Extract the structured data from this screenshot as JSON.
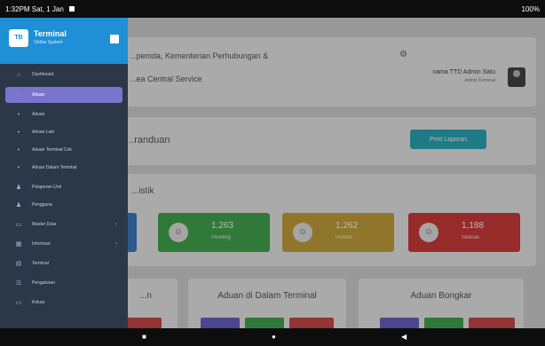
{
  "status_bar": {
    "left_text": "1:32PM Sat, 1 Jan",
    "right_text": "100%"
  },
  "header": {
    "title_line1": "...pemda, Kementerian Perhubungan &",
    "title_line2": "...ea Central Service",
    "user_name": "nama TTD Admin Satu",
    "user_role": "Admin Terminal"
  },
  "page": {
    "title": "...randuan",
    "print_button": "Print Laporan"
  },
  "stats": {
    "title": "...istik",
    "items": [
      {
        "num": "",
        "label": "",
        "color": "#3b7dc4"
      },
      {
        "num": "1,263",
        "label": "Pending",
        "color": "#43a84e"
      },
      {
        "num": "1,262",
        "label": "Proses",
        "color": "#c8a43b"
      },
      {
        "num": "1,188",
        "label": "Selesai",
        "color": "#d13c39"
      }
    ]
  },
  "lower_cards": [
    {
      "title": "...n"
    },
    {
      "title": "Aduan di Dalam Terminal"
    },
    {
      "title": "Aduan Bongkar"
    }
  ],
  "sidebar": {
    "app_title": "Terminal",
    "app_subtitle": "Online System",
    "items": [
      {
        "label": "Dashboard",
        "icon": "home-icon",
        "active": false
      },
      {
        "label": "Aduan",
        "icon": "circle-icon",
        "active": true
      },
      {
        "label": "Aduan",
        "icon": "dot-icon",
        "active": false
      },
      {
        "label": "Aduan Lain",
        "icon": "dot-icon",
        "active": false
      },
      {
        "label": "Aduan Terminal Cek",
        "icon": "dot-icon",
        "active": false
      },
      {
        "label": "Aduan Dalam Terminal",
        "icon": "dot-icon",
        "active": false
      },
      {
        "label": "Pelaporan Unit",
        "icon": "user-icon",
        "active": false
      },
      {
        "label": "Pengguna",
        "icon": "user-icon",
        "active": false
      },
      {
        "label": "Master Data",
        "icon": "monitor-icon",
        "active": false,
        "chevron": true
      },
      {
        "label": "Informasi",
        "icon": "building-icon",
        "active": false,
        "chevron": true
      },
      {
        "label": "Terminal",
        "icon": "grid-icon",
        "active": false
      },
      {
        "label": "Pengaturan",
        "icon": "list-icon",
        "active": false
      },
      {
        "label": "Keluar",
        "icon": "monitor-icon",
        "active": false
      }
    ]
  }
}
